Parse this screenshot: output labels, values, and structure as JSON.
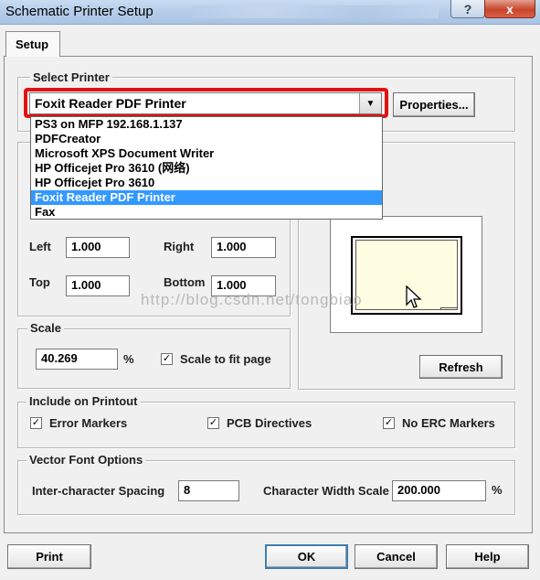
{
  "window": {
    "title": "Schematic Printer Setup",
    "help_glyph": "?",
    "close_glyph": "x"
  },
  "tabs": [
    {
      "label": "Setup"
    }
  ],
  "select_printer": {
    "legend": "Select Printer",
    "selected": "Foxit Reader PDF Printer",
    "arrow_glyph": "▼",
    "properties_button": "Properties...",
    "options": [
      "PS3 on MFP 192.168.1.137",
      "PDFCreator",
      "Microsoft XPS Document Writer",
      "HP Officejet Pro 3610 (网络)",
      "HP Officejet Pro 3610",
      "Foxit Reader PDF Printer",
      "Fax"
    ],
    "highlighted_index": 5
  },
  "margins": {
    "legend_visible": "M",
    "left_label": "Left",
    "left_value": "1.000",
    "right_label": "Right",
    "right_value": "1.000",
    "top_label": "Top",
    "top_value": "1.000",
    "bottom_label": "Bottom",
    "bottom_value": "1.000"
  },
  "scale": {
    "legend": "Scale",
    "value": "40.269",
    "unit": "%",
    "fit_checked": true,
    "fit_label": "Scale to fit page"
  },
  "preview": {
    "refresh_button": "Refresh"
  },
  "include_on_printout": {
    "legend": "Include on Printout",
    "items": [
      {
        "label": "Error Markers",
        "checked": true
      },
      {
        "label": "PCB Directives",
        "checked": true
      },
      {
        "label": "No ERC Markers",
        "checked": true
      }
    ]
  },
  "vector_font": {
    "legend": "Vector Font Options",
    "spacing_label": "Inter-character Spacing",
    "spacing_value": "8",
    "width_label": "Character Width Scale",
    "width_value": "200.000",
    "unit": "%"
  },
  "footer": {
    "print": "Print",
    "ok": "OK",
    "cancel": "Cancel",
    "help": "Help"
  },
  "watermark": "http://blog.csdn.net/tongbiao",
  "check_glyph": "✓",
  "colors": {
    "highlight_border": "#e21111",
    "selection": "#3399ff"
  }
}
